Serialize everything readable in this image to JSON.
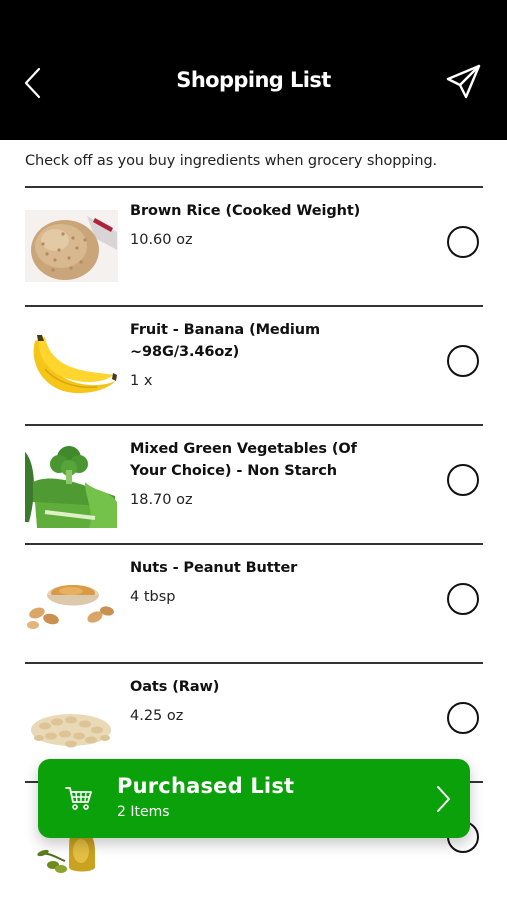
{
  "header": {
    "title": "Shopping List",
    "back_icon": "chevron-left-icon",
    "send_icon": "paper-plane-icon"
  },
  "instructions": "Check off as you buy ingredients when grocery shopping.",
  "items": [
    {
      "name": "Brown Rice (Cooked Weight)",
      "qty": "10.60 oz",
      "icon": "brown-rice-image",
      "checked": false
    },
    {
      "name": "Fruit - Banana (Medium ~98G/3.46oz)",
      "qty": "1 x",
      "icon": "banana-image",
      "checked": false
    },
    {
      "name": "Mixed Green Vegetables (Of Your Choice) - Non Starch",
      "qty": "18.70 oz",
      "icon": "green-vegetables-image",
      "checked": false
    },
    {
      "name": "Nuts - Peanut Butter",
      "qty": "4 tbsp",
      "icon": "peanut-butter-image",
      "checked": false
    },
    {
      "name": "Oats (Raw)",
      "qty": "4.25 oz",
      "icon": "oats-image",
      "checked": false
    },
    {
      "name": "",
      "qty": "",
      "icon": "olive-oil-image",
      "checked": false
    }
  ],
  "purchased": {
    "title": "Purchased List",
    "count": "2 Items",
    "icon": "cart-icon",
    "chevron_icon": "chevron-right-icon"
  },
  "colors": {
    "header_bg": "#000000",
    "accent_green": "#0aa10a",
    "divider": "#333333"
  }
}
